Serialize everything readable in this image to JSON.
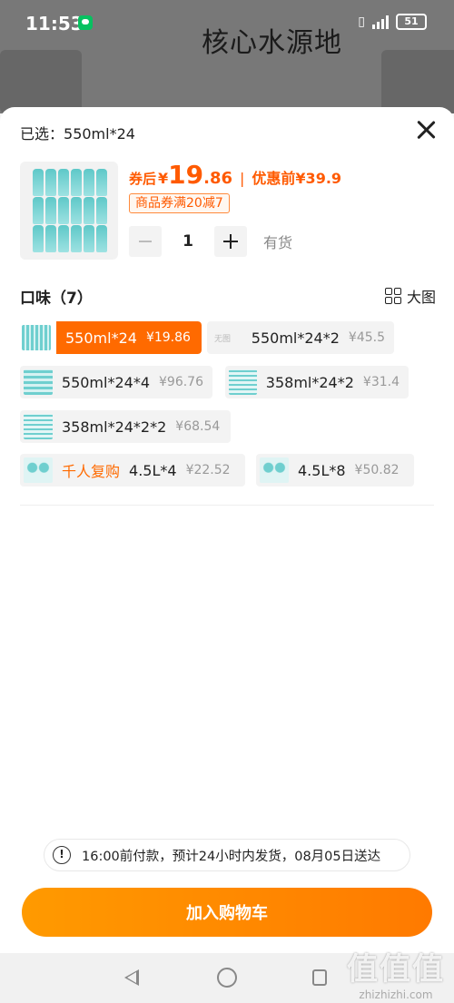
{
  "status_bar": {
    "time": "11:53",
    "battery": "51"
  },
  "background": {
    "title": "核心水源地"
  },
  "sheet": {
    "selected_label": "已选：",
    "selected_value": "550ml*24",
    "price": {
      "coupon_label": "券后",
      "currency": "¥",
      "int": "19",
      "dec": ".86",
      "separator": "|",
      "original_label": "优惠前",
      "original_price": "¥39.9"
    },
    "coupon_badge": "商品券满20减7",
    "quantity": "1",
    "stock": "有货",
    "flavor_title": "口味（7）",
    "big_view_label": "大图",
    "options": [
      {
        "label": "550ml*24",
        "price": "¥19.86",
        "selected": true
      },
      {
        "label": "550ml*24*2",
        "price": "¥45.5",
        "thumb_text": "无图"
      },
      {
        "label": "550ml*24*4",
        "price": "¥96.76"
      },
      {
        "label": "358ml*24*2",
        "price": "¥31.4"
      },
      {
        "label": "358ml*24*2*2",
        "price": "¥68.54"
      },
      {
        "label": "4.5L*4",
        "price": "¥22.52",
        "tag": "千人复购"
      },
      {
        "label": "4.5L*8",
        "price": "¥50.82"
      }
    ],
    "notice": "16:00前付款，预计24小时内发货，08月05日送达",
    "cart_button": "加入购物车"
  },
  "watermark": {
    "logo": "值值值",
    "url": "zhizhizhi.com"
  },
  "colors": {
    "accent": "#ff6a00",
    "button": "#ff8a00"
  }
}
